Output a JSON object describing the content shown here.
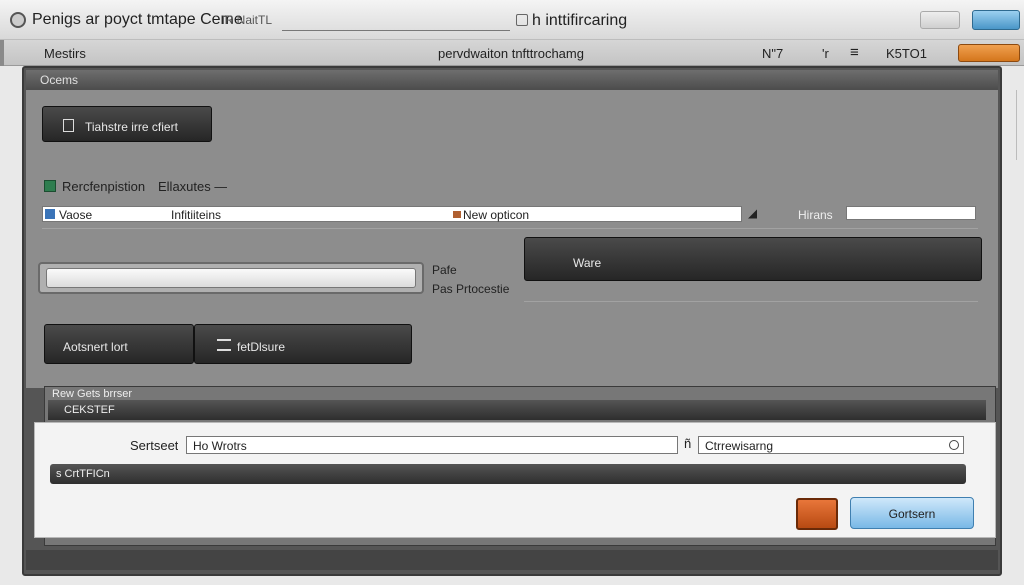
{
  "window": {
    "title": "Penigs ar poyct tmtape Ceme",
    "title_tab": "iR NaitTL",
    "title_center": "h inttifircaring"
  },
  "menubar": {
    "left": "Mestirs",
    "center": "pervdwaiton tnfttrochamg",
    "right_a": "N\"7",
    "right_b": "'r",
    "right_c": "≡",
    "right_d": "K5TO1"
  },
  "panel": {
    "header": "Ocems",
    "top_button": "Tiahstre irre cfiert",
    "section_label": "Rercfenpistion",
    "section_label2": "Ellaxutes —",
    "row": {
      "left_label": "Vaose",
      "left_value": "Infitiiteins",
      "dropdown_value": "New opticon",
      "right_label": "Hirans"
    },
    "side_text_1": "Pafe",
    "side_text_2": "Pas Prtocestie",
    "wide_button": "Ware",
    "btn_left": "Aotsnert lort",
    "btn_right": "fetDlsure"
  },
  "lower": {
    "group_title": "Rew Gets brrser",
    "bar_label": "CEKSTEF",
    "search_label": "Sertseet",
    "search_value": "Ho Wrotrs",
    "mid_glyph": "ñ",
    "select_value": "Ctrrewisarng",
    "bar2_label": "s CrtTFICn",
    "primary_button": "Gortsern"
  }
}
